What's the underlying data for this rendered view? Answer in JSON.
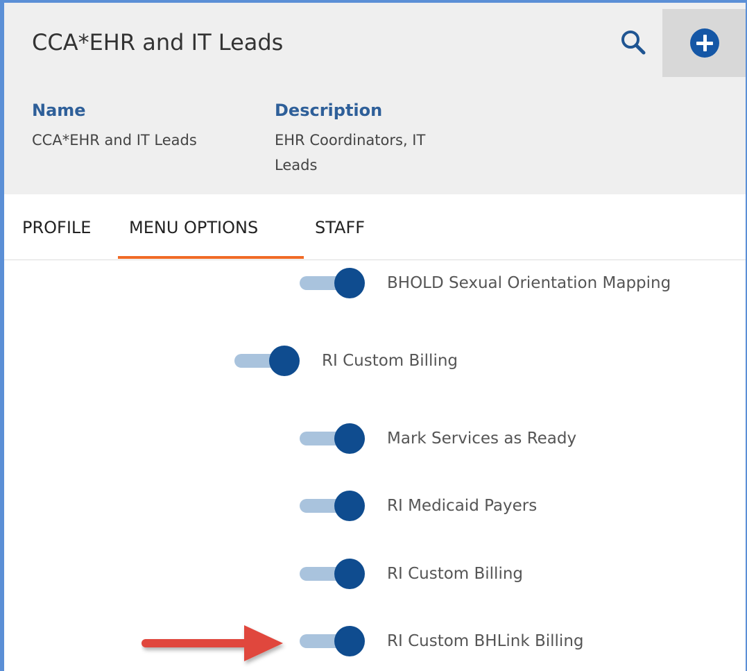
{
  "header": {
    "title": "CCA*EHR and IT Leads",
    "search_icon": "search-icon",
    "add_icon": "plus-circle-icon"
  },
  "fields": {
    "name_label": "Name",
    "name_value": "CCA*EHR and IT Leads",
    "description_label": "Description",
    "description_value": "EHR Coordinators, IT Leads"
  },
  "tabs": [
    {
      "label": "PROFILE",
      "active": false
    },
    {
      "label": "MENU OPTIONS",
      "active": true
    },
    {
      "label": "STAFF",
      "active": false
    }
  ],
  "menu_options": [
    {
      "label": "BHOLD Sexual Orientation Mapping",
      "enabled": true
    },
    {
      "label": "RI Custom Billing",
      "enabled": true
    },
    {
      "label": "Mark Services as Ready",
      "enabled": true
    },
    {
      "label": "RI Medicaid Payers",
      "enabled": true
    },
    {
      "label": "RI Custom Billing",
      "enabled": true
    },
    {
      "label": "RI Custom BHLink Billing",
      "enabled": true
    }
  ],
  "colors": {
    "accent_blue": "#2e5f99",
    "toggle_knob": "#0f4c8f",
    "toggle_track": "#a9c3dd",
    "active_tab_underline": "#f06a26",
    "annotation_arrow": "#e0463c"
  }
}
